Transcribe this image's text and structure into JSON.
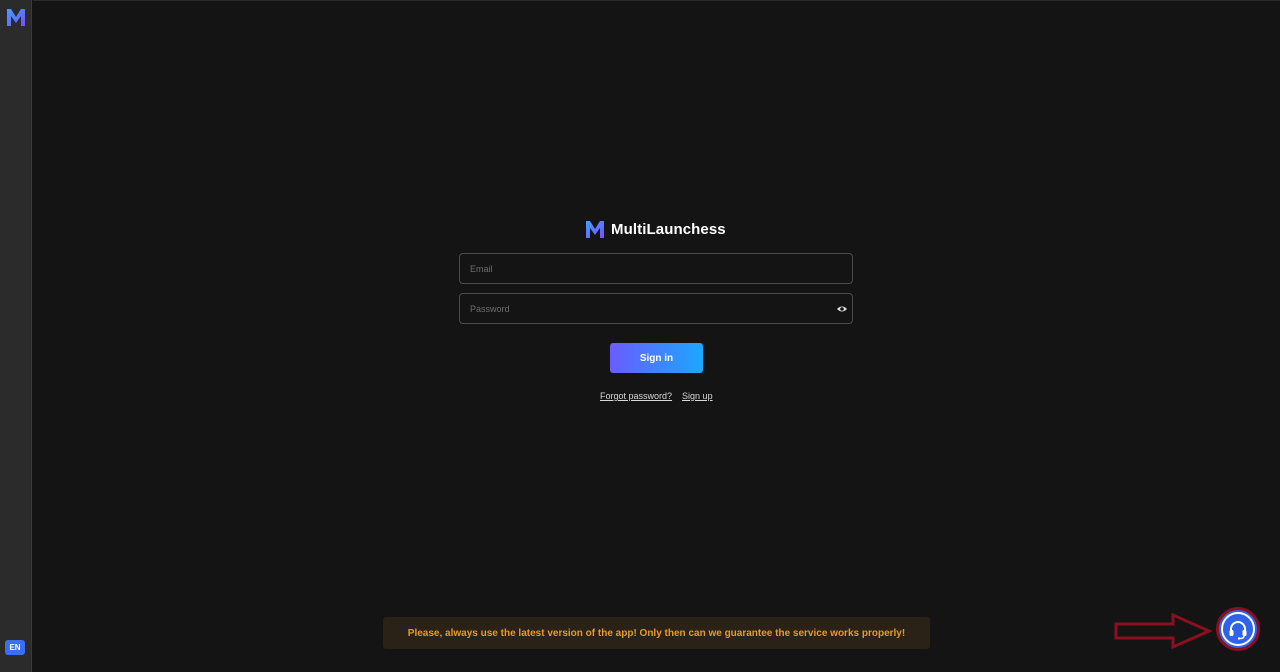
{
  "app": {
    "title": "MultiLaunchess"
  },
  "sidebar": {
    "language": "EN"
  },
  "login": {
    "email_placeholder": "Email",
    "password_placeholder": "Password",
    "sign_in_label": "Sign in",
    "forgot_password_label": "Forgot password?",
    "sign_up_label": "Sign up"
  },
  "notice": {
    "text": "Please, always use the latest version of the app! Only then can we guarantee the service works properly!"
  },
  "colors": {
    "background": "#141414",
    "accent_start": "#6a5cff",
    "accent_end": "#1aa8ff",
    "notice_text": "#e89a23",
    "support_button": "#2f63e8",
    "arrow_outline": "#8a1020"
  },
  "icons": {
    "app_logo": "m-logo-icon",
    "password_toggle": "eye-icon",
    "support": "headset-icon",
    "pointer": "arrow-right-icon"
  }
}
